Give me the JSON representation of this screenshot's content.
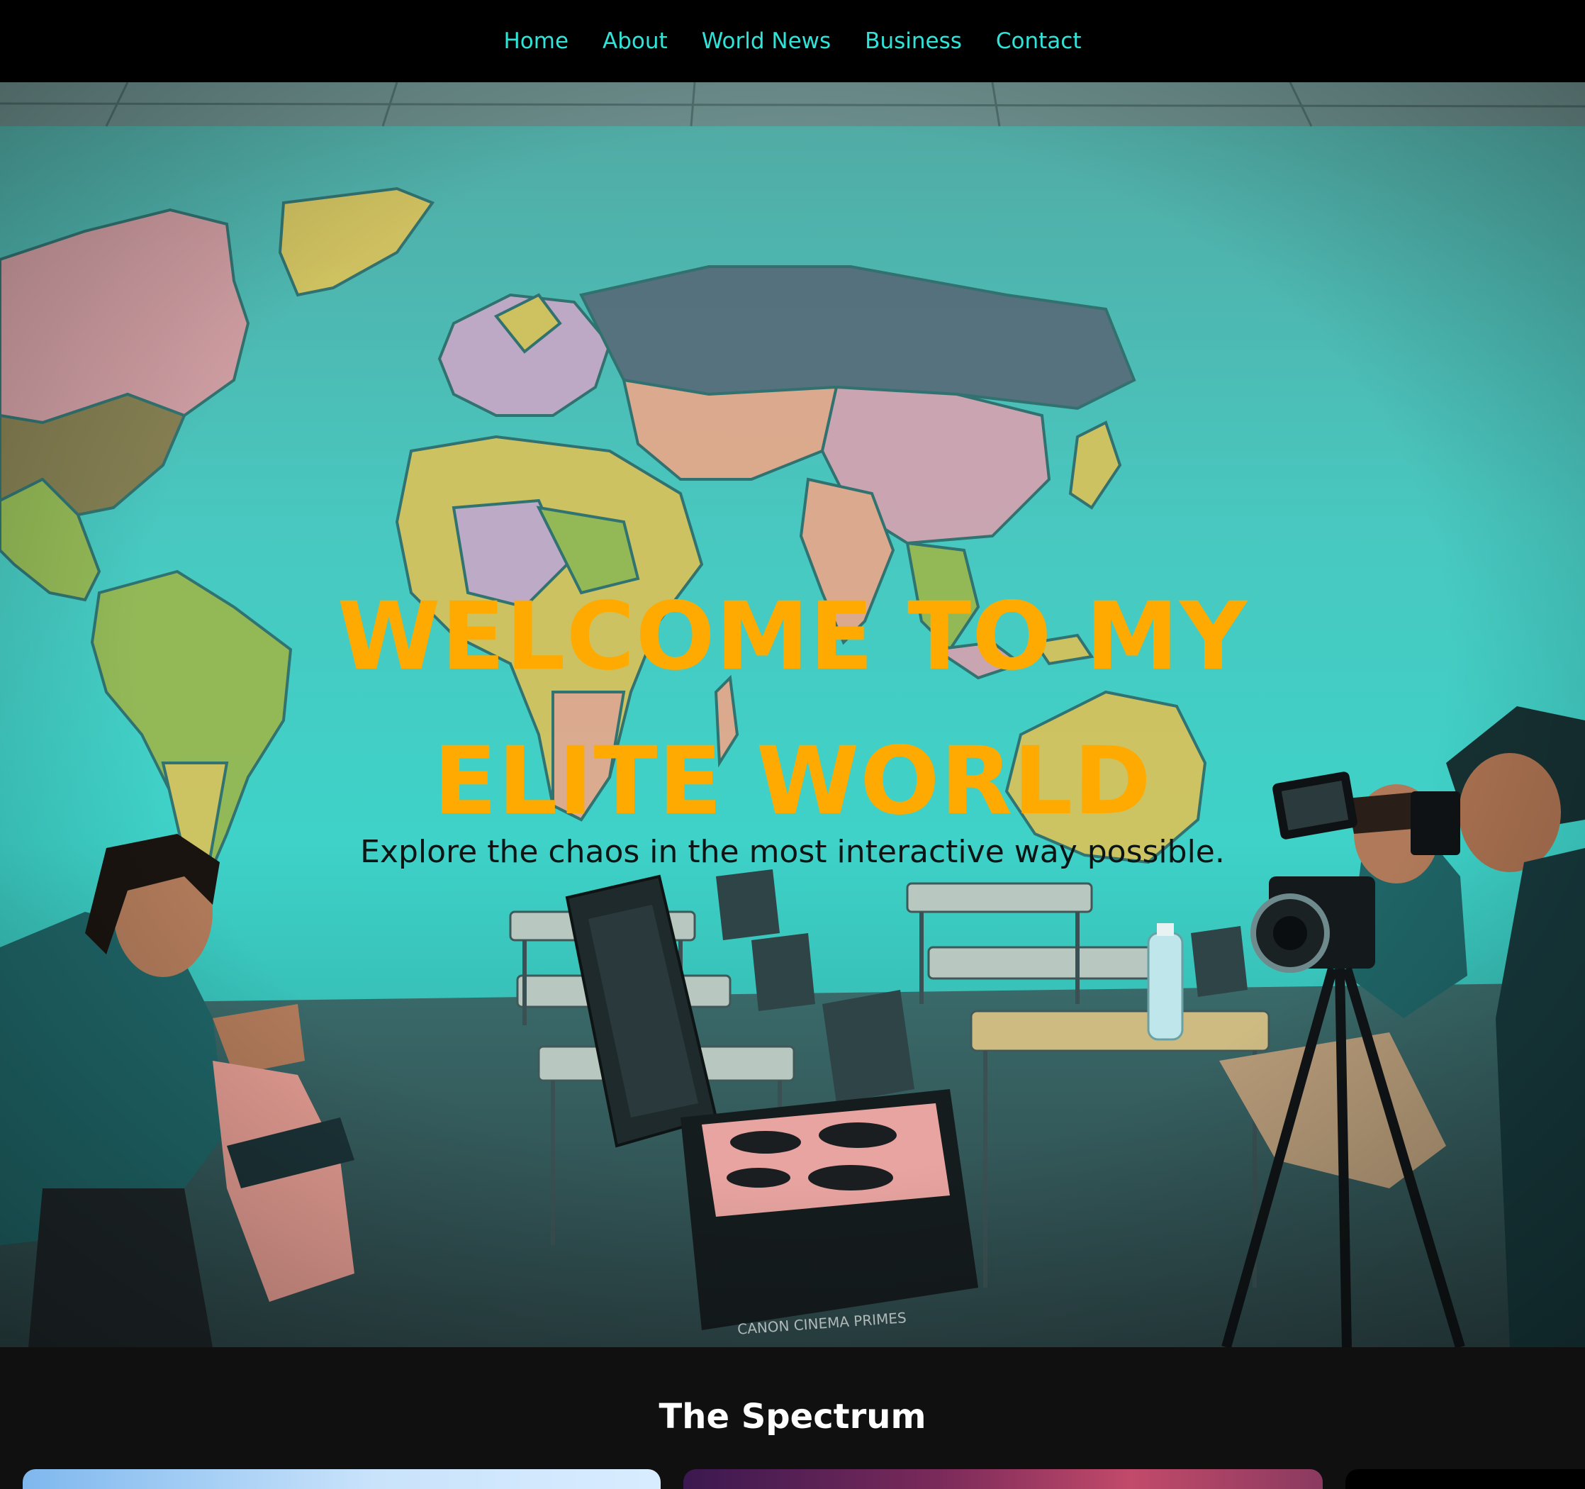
{
  "nav": {
    "items": [
      {
        "label": "Home"
      },
      {
        "label": "About"
      },
      {
        "label": "World News"
      },
      {
        "label": "Business"
      },
      {
        "label": "Contact"
      }
    ]
  },
  "hero": {
    "title": "WELCOME TO MY ELITE WORLD",
    "subtitle": "Explore the chaos in the most interactive way possible.",
    "photo_case_label": "CANON CINEMA PRIMES",
    "colors": {
      "title": "#ffaa00",
      "nav_link": "#2fe3d8",
      "wall": "#3fbcb4"
    }
  },
  "spectrum": {
    "heading": "The Spectrum"
  }
}
